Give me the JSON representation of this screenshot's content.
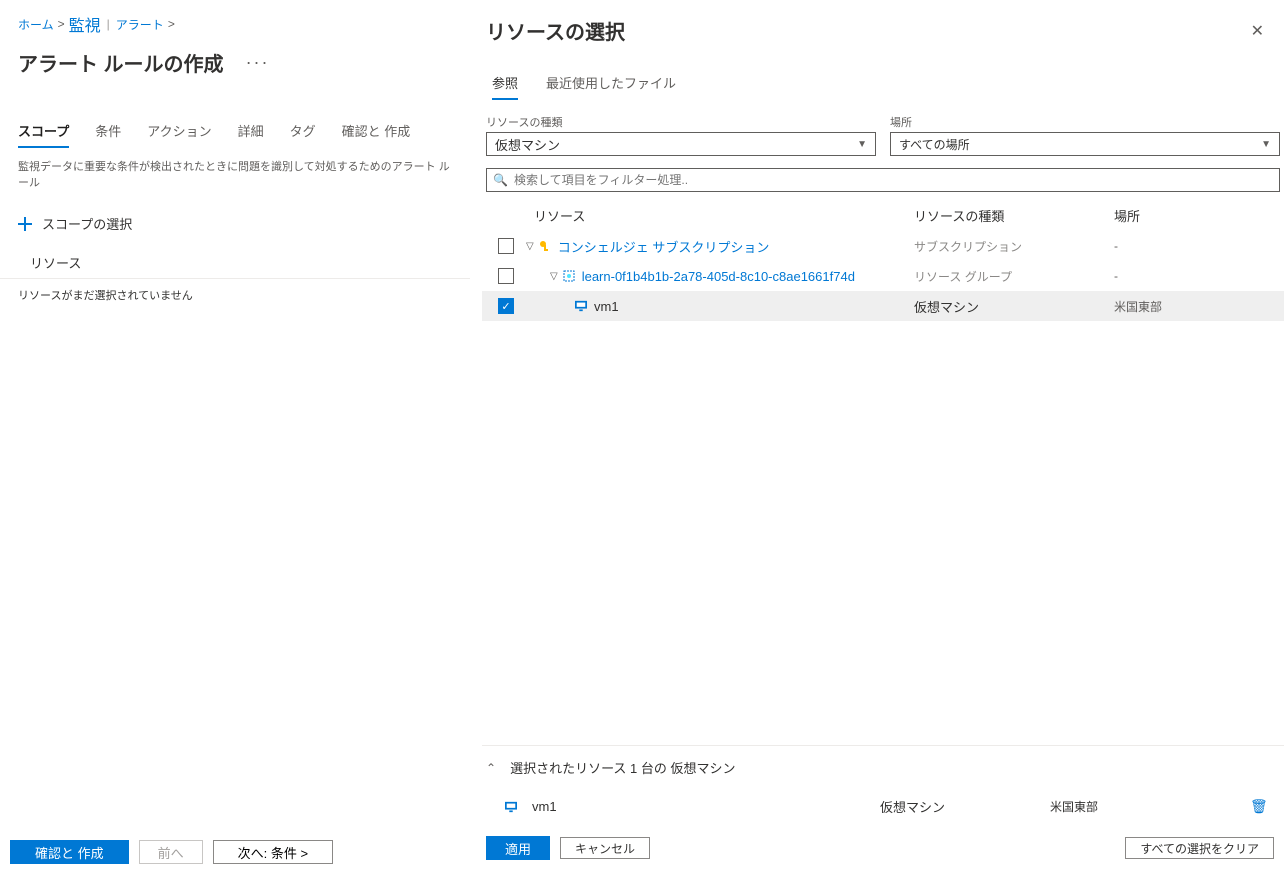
{
  "breadcrumb": {
    "home": "ホーム",
    "monitor": "監視",
    "alerts": "アラート"
  },
  "pageTitle": "アラート ルールの作成",
  "mainTabs": {
    "scope": "スコープ",
    "condition": "条件",
    "actions": "アクション",
    "details": "詳細",
    "tags": "タグ",
    "review": "確認と 作成"
  },
  "tabDescription": "監視データに重要な条件が検出されたときに問題を識別して対処するためのアラート ルール",
  "selectScopeLabel": "スコープの選択",
  "resourceHeader": "リソース",
  "noResourceMsg": "リソースがまだ選択されていません",
  "footerLeft": {
    "review": "確認と 作成",
    "prev": "前へ",
    "next": "次へ: 条件  >"
  },
  "panel": {
    "title": "リソースの選択",
    "tabs": {
      "browse": "参照",
      "recent": "最近使用したファイル"
    },
    "filters": {
      "typeLabel": "リソースの種類",
      "typeValue": "仮想マシン",
      "locLabel": "場所",
      "locValue": "すべての場所"
    },
    "searchPlaceholder": "検索して項目をフィルター処理..",
    "columns": {
      "res": "リソース",
      "type": "リソースの種類",
      "loc": "場所"
    },
    "rows": [
      {
        "indent": 0,
        "checked": false,
        "name": "コンシェルジェ サブスクリプション",
        "link": true,
        "typeText": "サブスクリプション",
        "strongType": false,
        "loc": "-",
        "icon": "key",
        "expandable": true
      },
      {
        "indent": 1,
        "checked": false,
        "name": "learn-0f1b4b1b-2a78-405d-8c10-c8ae1661f74d",
        "link": true,
        "typeText": "リソース グループ",
        "strongType": false,
        "loc": "-",
        "icon": "rg",
        "expandable": true
      },
      {
        "indent": 2,
        "checked": true,
        "name": "vm1",
        "link": false,
        "typeText": "仮想マシン",
        "strongType": true,
        "loc": "米国東部",
        "icon": "vm",
        "expandable": false
      }
    ],
    "summaryTitle": "選択されたリソース 1 台の 仮想マシン",
    "summaryItem": {
      "name": "vm1",
      "type": "仮想マシン",
      "loc": "米国東部"
    },
    "footer": {
      "apply": "適用",
      "cancel": "キャンセル",
      "clear": "すべての選択をクリア"
    }
  }
}
